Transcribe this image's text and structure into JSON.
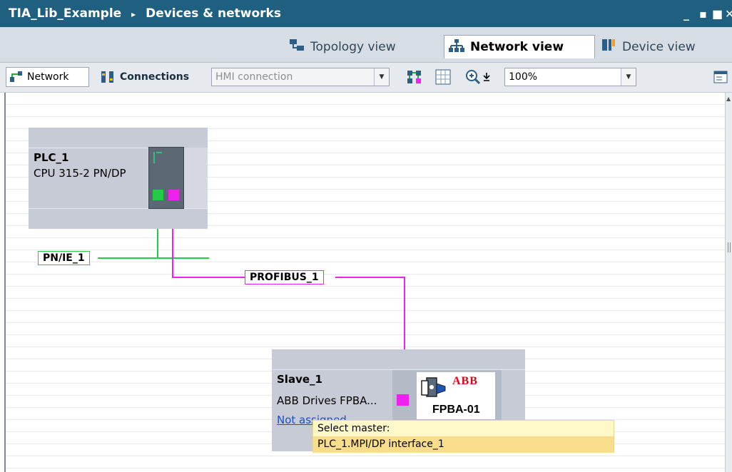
{
  "titlebar": {
    "breadcrumb_project": "TIA_Lib_Example",
    "breadcrumb_separator": "▸",
    "breadcrumb_page": "Devices & networks",
    "minimize": "_",
    "restore": "▪",
    "maximize": "■",
    "close": "✕"
  },
  "tabs": {
    "topology": "Topology view",
    "network": "Network view",
    "device": "Device view"
  },
  "toolbar": {
    "network_label": "Network",
    "connections_label": "Connections",
    "connection_type": "HMI connection",
    "zoom": "100%"
  },
  "devices": {
    "plc": {
      "name": "PLC_1",
      "type": "CPU 315-2 PN/DP"
    },
    "slave": {
      "name": "Slave_1",
      "type": "ABB Drives FPBA...",
      "assignment": "Not assigned",
      "module_brand": "ABB",
      "module_label": "FPBA-01"
    }
  },
  "networks": {
    "pn": "PN/IE_1",
    "profibus": "PROFIBUS_1"
  },
  "tooltip": {
    "title": "Select master:",
    "option": "PLC_1.MPI/DP interface_1"
  },
  "colors": {
    "titlebar": "#1f5f7f",
    "ethernet": "#22cc44",
    "profibus": "#ee22ee",
    "tooltip": "#fff8c8"
  }
}
